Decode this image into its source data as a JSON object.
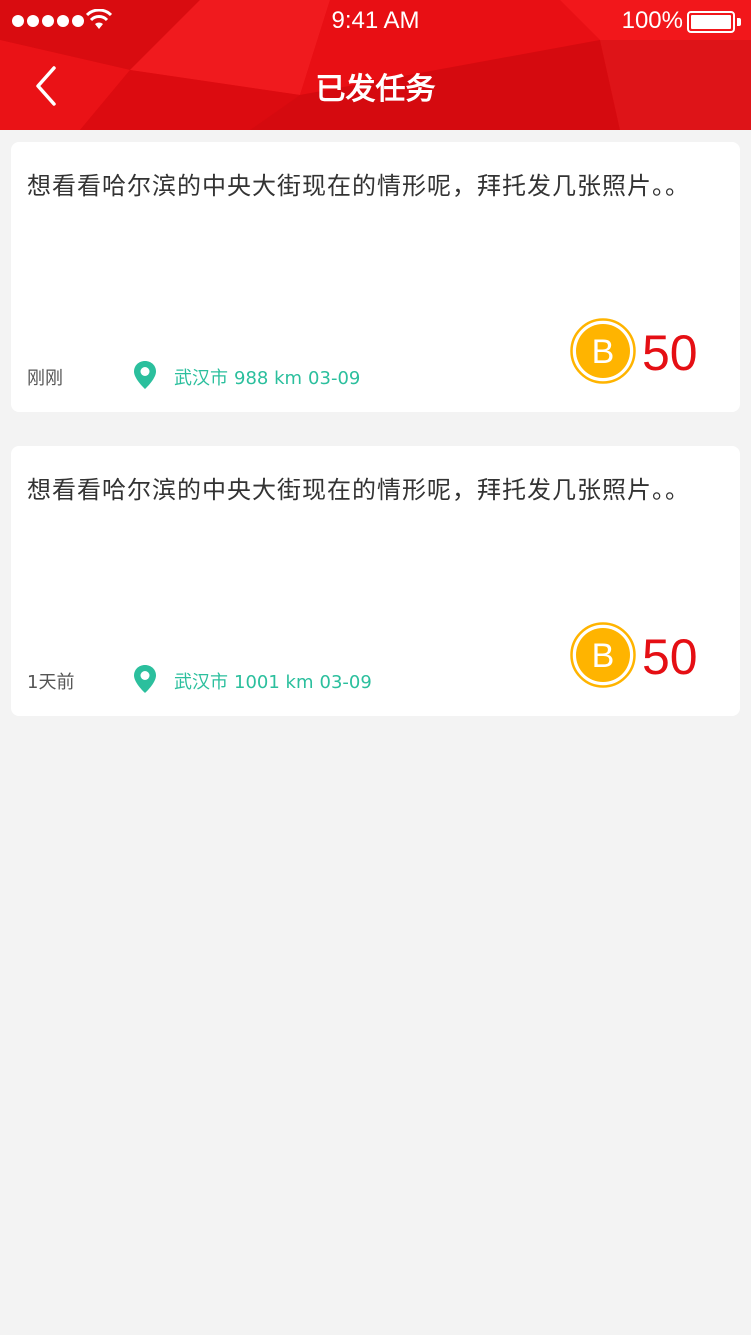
{
  "status_bar": {
    "time": "9:41 AM",
    "battery": "100%"
  },
  "nav": {
    "title": "已发任务"
  },
  "colors": {
    "brand_red": "#e50f14",
    "location_teal": "#2bbf9d",
    "coin_gold": "#ffb400",
    "page_bg": "#f3f3f3"
  },
  "tasks": [
    {
      "text": "想看看哈尔滨的中央大街现在的情形呢，拜托发几张照片。。",
      "posted": "刚刚",
      "city": "武汉市",
      "distance": "988 km",
      "date": "03-09",
      "reward": "50",
      "reward_icon": "coin-b-icon"
    },
    {
      "text": "想看看哈尔滨的中央大街现在的情形呢，拜托发几张照片。。",
      "posted": "1天前",
      "city": "武汉市",
      "distance": "1001 km",
      "date": "03-09",
      "reward": "50",
      "reward_icon": "coin-b-icon"
    }
  ]
}
